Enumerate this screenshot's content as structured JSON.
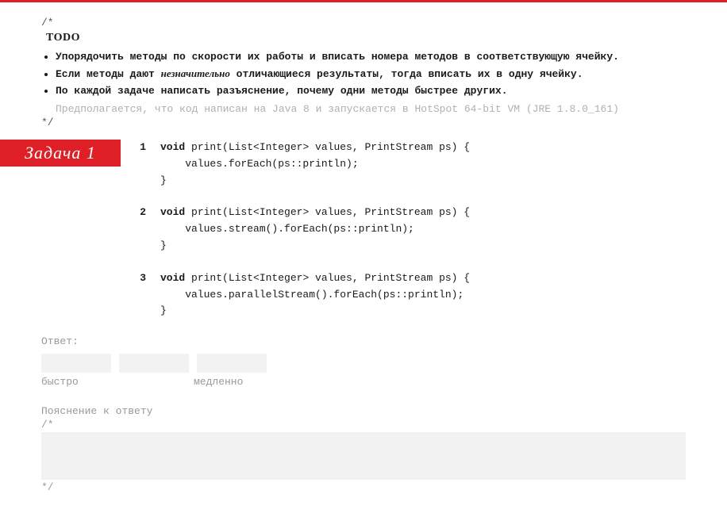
{
  "comment_open": "/*",
  "comment_close": "*/",
  "todo_heading": "TODO",
  "todo_items": [
    "Упорядочить методы по скорости их работы и вписать номера методов в соответствующую ячейку.",
    "Если методы дают <em>незначительно</em> отличающиеся результаты, тогда вписать их в одну ячейку.",
    "По каждой задаче написать разъяснение, почему одни методы быстрее других."
  ],
  "assumption": "Предполагается, что код написан на Java 8 и запускается  в HotSpot 64-bit VM (JRE 1.8.0_161)",
  "task_label": "Задача 1",
  "snippets": [
    {
      "n": "1",
      "lines": [
        "void print(List<Integer> values, PrintStream ps) {",
        "    values.forEach(ps::println);",
        "}"
      ]
    },
    {
      "n": "2",
      "lines": [
        "void print(List<Integer> values, PrintStream ps) {",
        "    values.stream().forEach(ps::println);",
        "}"
      ]
    },
    {
      "n": "3",
      "lines": [
        "void print(List<Integer> values, PrintStream ps) {",
        "    values.parallelStream().forEach(ps::println);",
        "}"
      ]
    }
  ],
  "answer_label": "Ответ:",
  "fast_label": "быстро",
  "slow_label": "медленно",
  "explanation_label": "Пояснение к ответу",
  "expl_open": "/*",
  "expl_close": "*/"
}
